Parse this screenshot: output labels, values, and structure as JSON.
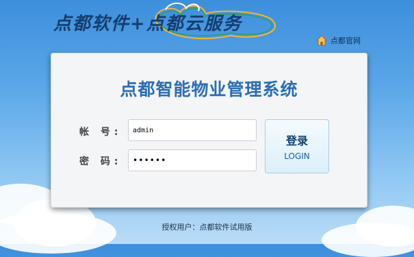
{
  "header": {
    "logo_text": "点都软件+点都云服务",
    "home_link_label": "点都官网",
    "home_icon": "house-icon"
  },
  "login_panel": {
    "title": "点都智能物业管理系统",
    "account_label": "帐  号:",
    "account_value": "admin",
    "password_label": "密  码:",
    "password_value": "••••••",
    "login_button_main": "登录",
    "login_button_sub": "LOGIN"
  },
  "footer": {
    "license_text": "授权用户：点都软件试用版"
  },
  "colors": {
    "title_blue": "#2a6db3",
    "background_top": "#3d8fdc",
    "background_bottom": "#b9dcf7"
  }
}
